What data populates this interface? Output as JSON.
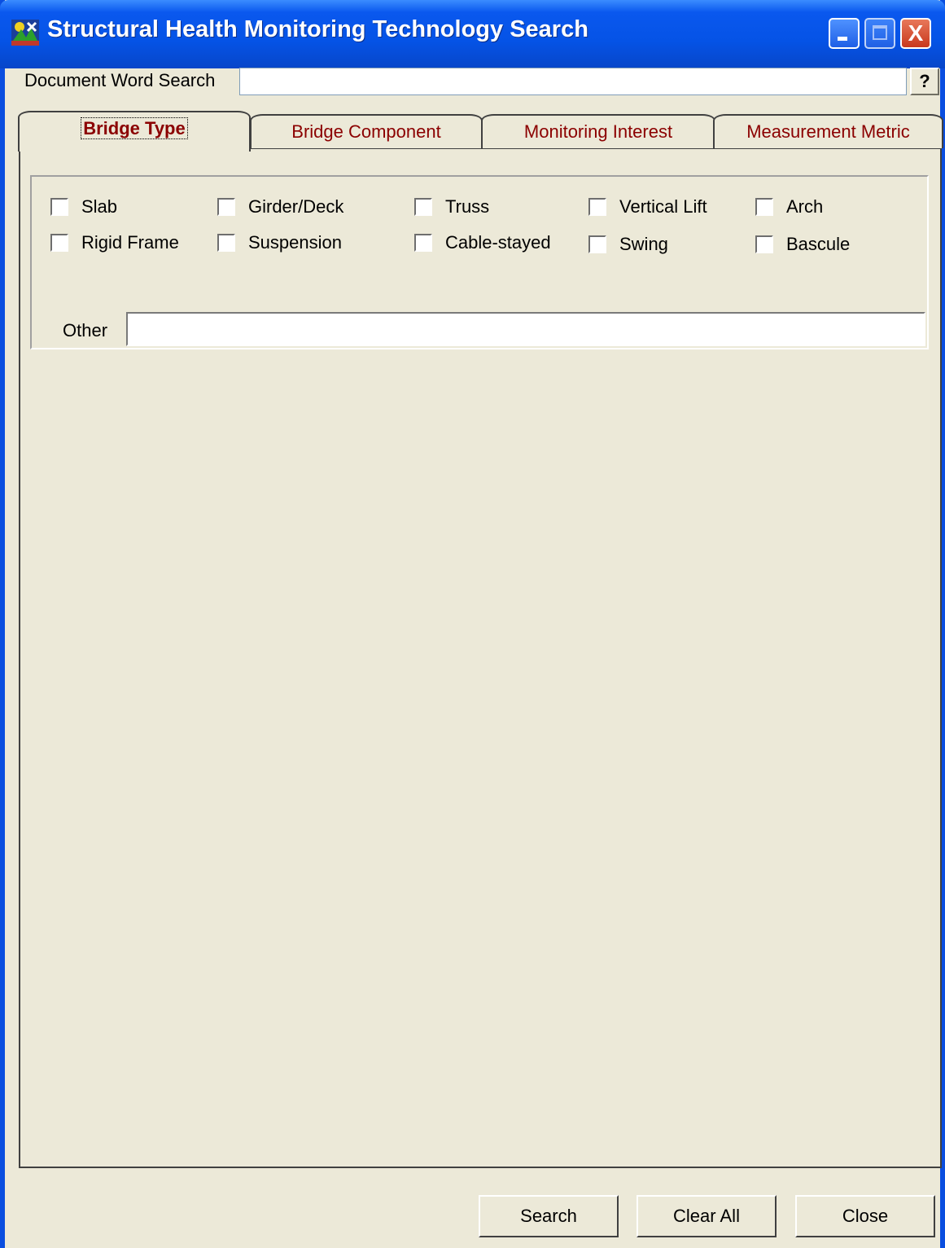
{
  "window": {
    "title": "Structural Health Monitoring Technology Search",
    "close_glyph": "X"
  },
  "search": {
    "label": "Document Word Search",
    "value": "",
    "help_label": "?"
  },
  "tabs": [
    {
      "label": "Bridge Type",
      "active": true
    },
    {
      "label": "Bridge Component",
      "active": false
    },
    {
      "label": "Monitoring Interest",
      "active": false
    },
    {
      "label": "Measurement Metric",
      "active": false
    }
  ],
  "bridge_types": [
    {
      "label": "Slab",
      "checked": false
    },
    {
      "label": "Girder/Deck",
      "checked": false
    },
    {
      "label": "Truss",
      "checked": false
    },
    {
      "label": "Vertical Lift",
      "checked": false
    },
    {
      "label": "Arch",
      "checked": false
    },
    {
      "label": "Rigid Frame",
      "checked": false
    },
    {
      "label": "Suspension",
      "checked": false
    },
    {
      "label": "Cable-stayed",
      "checked": false
    },
    {
      "label": "Swing",
      "checked": false
    },
    {
      "label": "Bascule",
      "checked": false
    }
  ],
  "other": {
    "label": "Other",
    "value": ""
  },
  "buttons": {
    "search": "Search",
    "clear_all": "Clear All",
    "close": "Close"
  },
  "colors": {
    "titlebar": "#0553e6",
    "tab_text": "#8b0000",
    "dialog_bg": "#ece9d8"
  },
  "icons": {
    "app": "bridge-app-icon",
    "minimize": "minimize-icon",
    "maximize": "maximize-icon",
    "close": "close-icon"
  }
}
